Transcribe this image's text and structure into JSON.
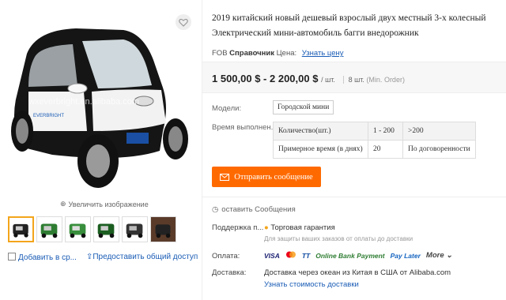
{
  "gallery": {
    "zoom_label": "Увеличить изображение",
    "thumb_count": 6
  },
  "left_actions": {
    "compare_label": "Добавить в ср...",
    "share_label": "Предоставить общий доступ"
  },
  "product": {
    "title": "2019 китайский новый дешевый взрослый двух местный 3-х колесный Электрический мини-автомобиль багги внедорожник",
    "fob_label": "FOB",
    "ref_label": "Справочник",
    "price_label": "Цена:",
    "get_price_link": "Узнать цену",
    "price": "1 500,00 $ - 2 200,00 $",
    "price_unit": "/ шт.",
    "moq": "8 шт.",
    "moq_note": "(Min. Order)"
  },
  "models": {
    "label": "Модели:",
    "value": "Городской мини"
  },
  "lead_time": {
    "label": "Время выполнен...",
    "rows": [
      [
        "Количество(шт.)",
        "1 - 200",
        ">200"
      ],
      [
        "Примерное время (в днях)",
        "20",
        "По договоренности"
      ]
    ]
  },
  "send_button": "Отправить сообщение",
  "leave_message": "оставить Сообщения",
  "trade": {
    "label": "Поддержка п...",
    "value": "Торговая гарантия",
    "sub": "Для защиты ваших заказов от оплаты до доставки"
  },
  "payment": {
    "label": "Оплата:",
    "methods": [
      "VISA",
      "TT",
      "Online Bank Payment",
      "Pay Later"
    ],
    "more": "More"
  },
  "shipping": {
    "label": "Доставка:",
    "value": "Доставка через океан из Китая в США от Alibaba.com",
    "link": "Узнать стоимость доставки"
  },
  "colors": {
    "accent": "#ff6a00",
    "link": "#1a5cb5",
    "thumb_active": "#f3a51b"
  },
  "watermark": "wxeverbright.en.alibaba.com"
}
